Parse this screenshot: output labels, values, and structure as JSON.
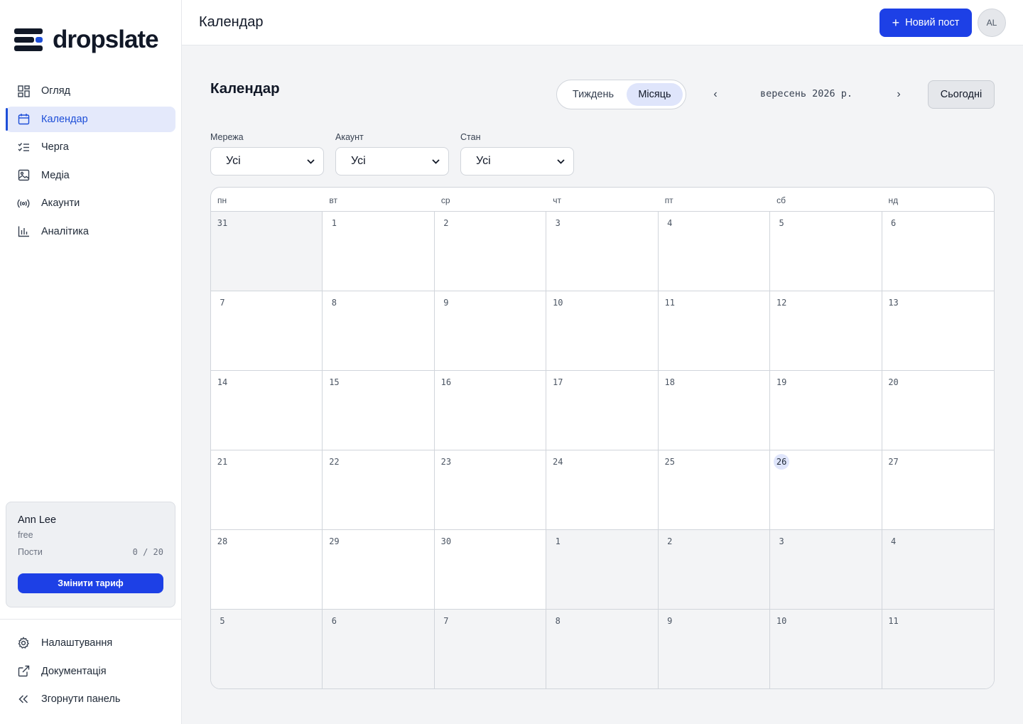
{
  "brand": {
    "name": "dropslate"
  },
  "sidebar": {
    "items": [
      {
        "label": "Огляд",
        "icon": "grid-icon"
      },
      {
        "label": "Календар",
        "icon": "calendar-icon",
        "active": true
      },
      {
        "label": "Черга",
        "icon": "checklist-icon"
      },
      {
        "label": "Медіа",
        "icon": "image-icon"
      },
      {
        "label": "Акаунти",
        "icon": "broadcast-icon"
      },
      {
        "label": "Аналітика",
        "icon": "bar-chart-icon"
      }
    ],
    "bottom": [
      {
        "label": "Налаштування",
        "icon": "gear-icon"
      },
      {
        "label": "Документація",
        "icon": "external-link-icon"
      },
      {
        "label": "Згорнути панель",
        "icon": "double-chevron-left-icon"
      }
    ]
  },
  "plan": {
    "user": "Ann Lee",
    "tier": "free",
    "posts_label": "Пости",
    "posts_count": "0 / 20",
    "upgrade_label": "Змінити тариф"
  },
  "header": {
    "title": "Календар",
    "new_post_label": "Новий пост",
    "avatar_initials": "AL"
  },
  "main": {
    "title": "Календар",
    "view_week": "Тиждень",
    "view_month": "Місяць",
    "month_label": "вересень 2026 р.",
    "prev": "‹",
    "next": "›",
    "today_label": "Сьогодні",
    "filters": [
      {
        "label": "Мережа",
        "value": "Усі"
      },
      {
        "label": "Акаунт",
        "value": "Усі"
      },
      {
        "label": "Стан",
        "value": "Усі"
      }
    ]
  },
  "calendar": {
    "weekdays": [
      "пн",
      "вт",
      "ср",
      "чт",
      "пт",
      "сб",
      "нд"
    ],
    "days": [
      {
        "d": "31",
        "out": true
      },
      {
        "d": "1"
      },
      {
        "d": "2"
      },
      {
        "d": "3"
      },
      {
        "d": "4"
      },
      {
        "d": "5"
      },
      {
        "d": "6"
      },
      {
        "d": "7"
      },
      {
        "d": "8"
      },
      {
        "d": "9"
      },
      {
        "d": "10"
      },
      {
        "d": "11"
      },
      {
        "d": "12"
      },
      {
        "d": "13"
      },
      {
        "d": "14"
      },
      {
        "d": "15"
      },
      {
        "d": "16"
      },
      {
        "d": "17"
      },
      {
        "d": "18"
      },
      {
        "d": "19"
      },
      {
        "d": "20"
      },
      {
        "d": "21"
      },
      {
        "d": "22"
      },
      {
        "d": "23"
      },
      {
        "d": "24"
      },
      {
        "d": "25"
      },
      {
        "d": "26",
        "today": true
      },
      {
        "d": "27"
      },
      {
        "d": "28"
      },
      {
        "d": "29"
      },
      {
        "d": "30"
      },
      {
        "d": "1",
        "out": true
      },
      {
        "d": "2",
        "out": true
      },
      {
        "d": "3",
        "out": true
      },
      {
        "d": "4",
        "out": true
      },
      {
        "d": "5",
        "out": true
      },
      {
        "d": "6",
        "out": true
      },
      {
        "d": "7",
        "out": true
      },
      {
        "d": "8",
        "out": true
      },
      {
        "d": "9",
        "out": true
      },
      {
        "d": "10",
        "out": true
      },
      {
        "d": "11",
        "out": true
      }
    ]
  },
  "colors": {
    "accent": "#1d40e6",
    "active_bg": "#e4e9fb",
    "today_bg": "#dfe5fb"
  }
}
